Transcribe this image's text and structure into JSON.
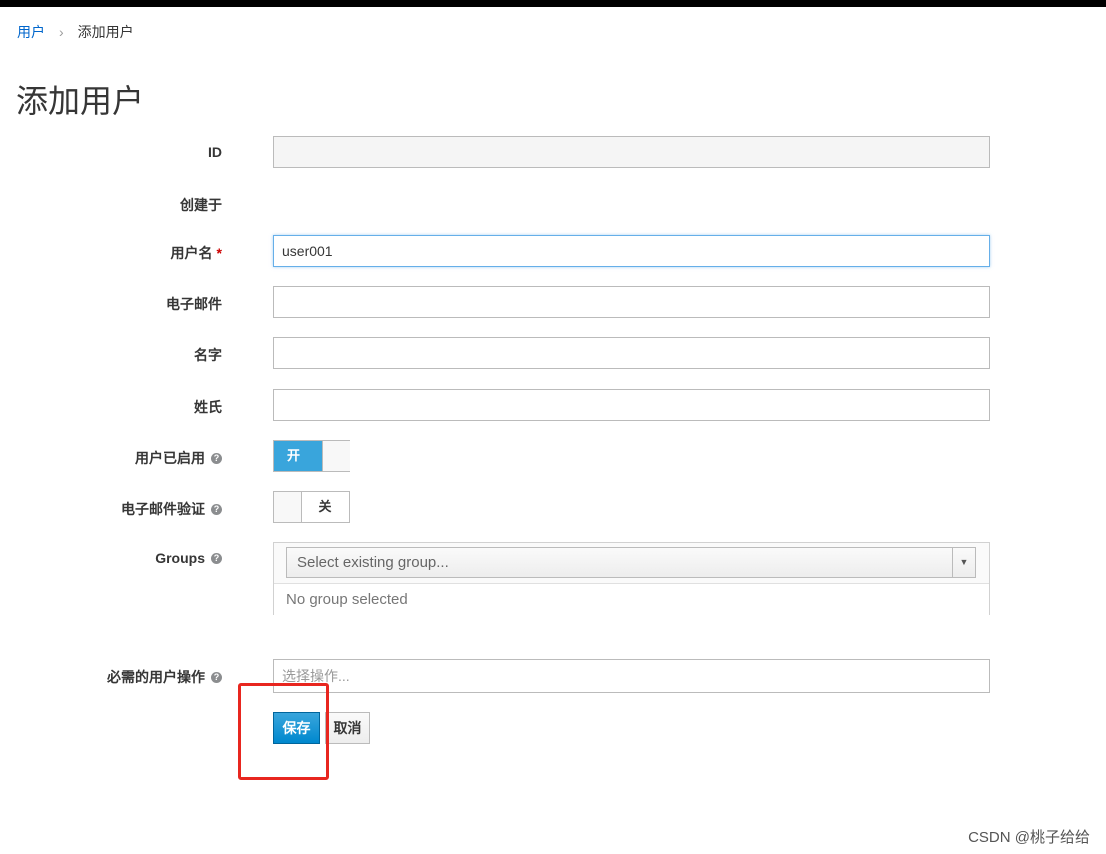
{
  "breadcrumb": {
    "parent": "用户",
    "current": "添加用户"
  },
  "page_title": "添加用户",
  "form": {
    "id": {
      "label": "ID",
      "value": ""
    },
    "created": {
      "label": "创建于",
      "value": ""
    },
    "username": {
      "label": "用户名",
      "required_mark": "*",
      "value": "user001"
    },
    "email": {
      "label": "电子邮件",
      "value": ""
    },
    "first_name": {
      "label": "名字",
      "value": ""
    },
    "last_name": {
      "label": "姓氏",
      "value": ""
    },
    "user_enabled": {
      "label": "用户已启用",
      "state": true,
      "on_text": "开"
    },
    "email_verified": {
      "label": "电子邮件验证",
      "state": false,
      "off_text": "关"
    },
    "groups": {
      "label": "Groups",
      "select_placeholder": "Select existing group...",
      "empty_text": "No group selected"
    },
    "required_actions": {
      "label": "必需的用户操作",
      "placeholder": "选择操作..."
    }
  },
  "buttons": {
    "save": "保存",
    "cancel": "取消"
  },
  "watermark": "CSDN @桃子给给",
  "colors": {
    "primary": "#0088ce",
    "highlight": "#e8261f",
    "required": "#cc0000"
  }
}
